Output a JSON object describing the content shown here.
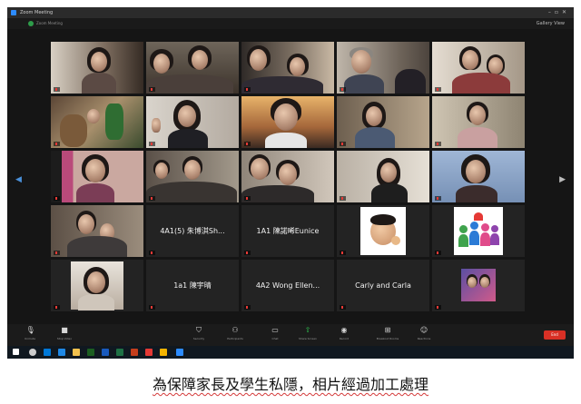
{
  "window": {
    "title": "Zoom Meeting"
  },
  "infobar": {
    "meeting_label": "Zoom Meeting",
    "view_label": "Gallery View"
  },
  "tiles": [
    {
      "id": "r1c1",
      "label": "",
      "name": ""
    },
    {
      "id": "r1c2",
      "label": "",
      "name": ""
    },
    {
      "id": "r1c3",
      "label": "",
      "name": ""
    },
    {
      "id": "r1c4",
      "label": "",
      "name": ""
    },
    {
      "id": "r1c5",
      "label": "",
      "name": ""
    },
    {
      "id": "r2c1",
      "label": "",
      "name": ""
    },
    {
      "id": "r2c2",
      "label": "",
      "name": ""
    },
    {
      "id": "r2c3",
      "label": "",
      "name": ""
    },
    {
      "id": "r2c4",
      "label": "",
      "name": ""
    },
    {
      "id": "r2c5",
      "label": "",
      "name": ""
    },
    {
      "id": "r3c1",
      "label": "",
      "name": ""
    },
    {
      "id": "r3c2",
      "label": "",
      "name": ""
    },
    {
      "id": "r3c3",
      "label": "",
      "name": ""
    },
    {
      "id": "r3c4",
      "label": "",
      "name": ""
    },
    {
      "id": "r3c5",
      "label": "",
      "name": ""
    },
    {
      "id": "r4c1",
      "label": "",
      "name": ""
    },
    {
      "id": "r4c2",
      "label": "4A1(5) 朱博淇Sh...",
      "name": ""
    },
    {
      "id": "r4c3",
      "label": "1A1 陳諾晞Eunice",
      "name": ""
    },
    {
      "id": "r4c4",
      "label": "",
      "name": ""
    },
    {
      "id": "r4c5",
      "label": "",
      "name": ""
    },
    {
      "id": "r5c1",
      "label": "",
      "name": ""
    },
    {
      "id": "r5c2",
      "label": "1a1 陳宇晴",
      "name": ""
    },
    {
      "id": "r5c3",
      "label": "4A2 Wong Ellen...",
      "name": ""
    },
    {
      "id": "r5c4",
      "label": "Carly and Carla",
      "name": ""
    },
    {
      "id": "r5c5",
      "label": "",
      "name": ""
    }
  ],
  "controls": [
    {
      "icon": "mic-icon",
      "label": "Unmute"
    },
    {
      "icon": "video-icon",
      "label": "Stop Video"
    },
    {
      "icon": "shield-icon",
      "label": "Security"
    },
    {
      "icon": "participants-icon",
      "label": "Participants"
    },
    {
      "icon": "chat-icon",
      "label": "Chat"
    },
    {
      "icon": "share-icon",
      "label": "Share Screen"
    },
    {
      "icon": "record-icon",
      "label": "Record"
    },
    {
      "icon": "breakout-icon",
      "label": "Breakout Rooms"
    },
    {
      "icon": "reactions-icon",
      "label": "Reactions"
    }
  ],
  "end_button": {
    "label": "End"
  },
  "caption": {
    "text": "為保障家長及學生私隱，相片經過加工處理"
  },
  "colors": {
    "zoom_blue": "#2d8cff",
    "share_green": "#2fc44f",
    "end_red": "#d93025"
  }
}
